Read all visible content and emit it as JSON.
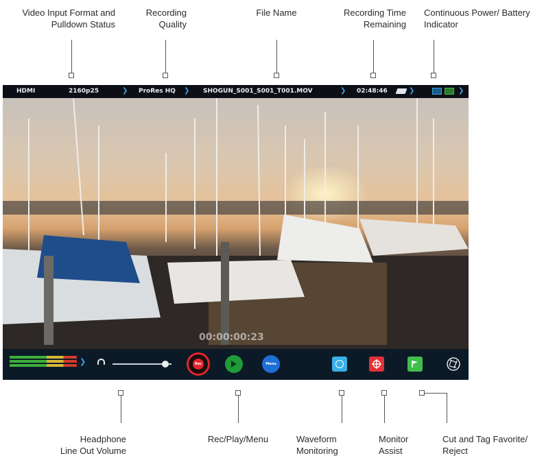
{
  "callouts": {
    "video_input": [
      "Video Input Format and",
      "Pulldown Status"
    ],
    "recording_quality": [
      "Recording",
      "Quality"
    ],
    "file_name": [
      "File Name"
    ],
    "recording_time": [
      "Recording Time",
      "Remaining"
    ],
    "power_battery": [
      "Continuous Power/ Battery",
      "Indicator"
    ],
    "headphone": [
      "Headphone",
      "Line Out Volume"
    ],
    "rec_play_menu": [
      "Rec/Play/Menu"
    ],
    "waveform": [
      "Waveform",
      "Monitoring"
    ],
    "monitor_assist": [
      "Monitor",
      "Assist"
    ],
    "cut_tag": [
      "Cut and Tag Favorite/",
      "Reject"
    ]
  },
  "topbar": {
    "input": "HDMI",
    "format": "2160p25",
    "codec": "ProRes HQ",
    "filename": "SHOGUN_S001_S001_T001.MOV",
    "time_remaining": "02:48:46"
  },
  "overlay": {
    "timecode": "00:00:00:23"
  },
  "buttons": {
    "rec": "Rec",
    "play": "Play",
    "menu": "Menu"
  },
  "icons": {
    "headphone": "headphone-icon",
    "waveform": "waveform-icon",
    "monitor_assist": "crosshair-icon",
    "flag": "flag-icon",
    "aperture": "aperture-icon",
    "disk": "disk-icon",
    "battery": "battery-icon"
  },
  "colors": {
    "rec": "#e2242b",
    "play": "#1f9b3a",
    "menu": "#1e6fd6",
    "waveform": "#3ab0e8",
    "monitor_assist": "#e23038",
    "flag": "#3fbf4a",
    "accent": "#3aa3e8"
  },
  "headphone_volume": 0.9
}
